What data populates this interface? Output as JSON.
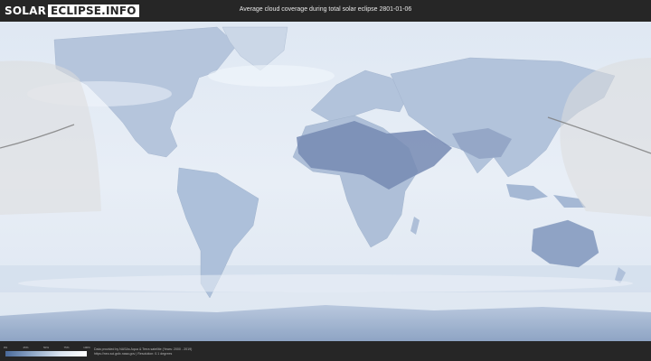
{
  "header": {
    "logo_part1": "SOLAR",
    "logo_part2": "ECLIPSE.INFO",
    "title": "Average cloud coverage during total solar eclipse 2801-01-06"
  },
  "legend": {
    "ticks": [
      "0%",
      "25%",
      "50%",
      "75%",
      "100%"
    ],
    "colors": [
      "#4a6a9a",
      "#8fa8c8",
      "#d9e4f0",
      "#ffffff"
    ]
  },
  "footer": {
    "credit_line1": "Data provided by NASAs Aqua & Terra satellite (Years: 2000 - 2019)",
    "credit_line2": "https://neo.sci.gsfc.nasa.gov | Resolution: 0.1 degrees"
  },
  "colors": {
    "ocean": "#e4ebf5",
    "land": "#b3c4dc",
    "dry_land": "#7589b3",
    "eclipse_path": "#7a7a7a",
    "eclipse_shadow": "#dcdcdc"
  }
}
